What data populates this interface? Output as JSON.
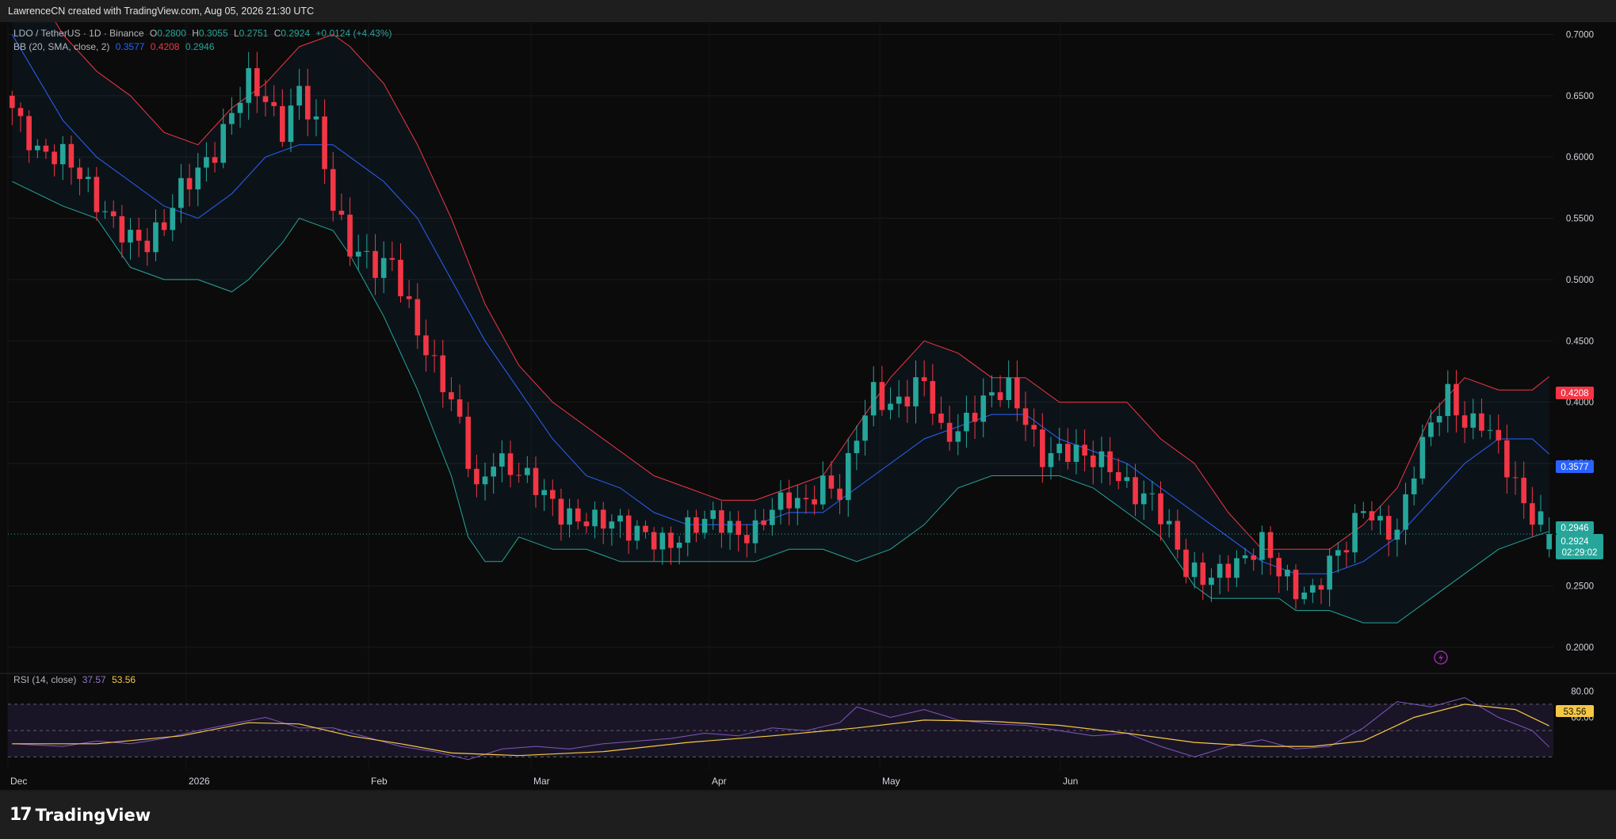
{
  "header": {
    "attribution": "LawrenceCN created with TradingView.com, Aug 05, 2026 21:30 UTC"
  },
  "legend": {
    "symbol": "LDO / TetherUS · 1D · Binance",
    "o_label": "O",
    "open": "0.2800",
    "h_label": "H",
    "high": "0.3055",
    "l_label": "L",
    "low": "0.2751",
    "c_label": "C",
    "close": "0.2924",
    "change": "+0.0124 (+4.43%)",
    "bb_name": "BB (20, SMA, close, 2)",
    "bb_basis": "0.3577",
    "bb_upper": "0.4208",
    "bb_lower": "0.2946"
  },
  "rsi_legend": {
    "name": "RSI (14, close)",
    "rsi": "37.57",
    "rsi_ma": "53.56"
  },
  "price_badges": {
    "bb_upper": "0.4208",
    "bb_basis": "0.3577",
    "bb_lower": "0.2946",
    "last_price": "0.2924",
    "countdown": "02:29:02"
  },
  "rsi_badge": "53.56",
  "brand": {
    "name": "TradingView",
    "mark": "17"
  },
  "colors": {
    "up": "#26a69a",
    "down": "#f23645",
    "basis": "#2962ff",
    "upper": "#f23645",
    "lower": "#26a69a",
    "rsi": "#7e57c2",
    "rsi_ma": "#f7c744"
  },
  "chart_data": {
    "type": "candlestick",
    "symbol": "LDO / TetherUS",
    "interval": "1D",
    "exchange": "Binance",
    "y_ticks": [
      0.7,
      0.65,
      0.6,
      0.55,
      0.5,
      0.45,
      0.4,
      0.35,
      0.25,
      0.2
    ],
    "y_tick_labels": [
      "0.7000",
      "0.6500",
      "0.6000",
      "0.5500",
      "0.5000",
      "0.4500",
      "0.4000",
      "0.3500",
      "0.2500",
      "0.2000"
    ],
    "y_range": [
      0.18,
      0.71
    ],
    "x_labels": [
      "Dec",
      "2026",
      "Feb",
      "Mar",
      "Apr",
      "May",
      "Jun"
    ],
    "close_path": [
      [
        0,
        0.64
      ],
      [
        3,
        0.61
      ],
      [
        6,
        0.6
      ],
      [
        8,
        0.58
      ],
      [
        10,
        0.56
      ],
      [
        12,
        0.55
      ],
      [
        14,
        0.54
      ],
      [
        16,
        0.53
      ],
      [
        18,
        0.54
      ],
      [
        20,
        0.57
      ],
      [
        22,
        0.59
      ],
      [
        24,
        0.61
      ],
      [
        26,
        0.64
      ],
      [
        28,
        0.66
      ],
      [
        30,
        0.64
      ],
      [
        32,
        0.62
      ],
      [
        34,
        0.66
      ],
      [
        36,
        0.63
      ],
      [
        38,
        0.56
      ],
      [
        40,
        0.52
      ],
      [
        43,
        0.51
      ],
      [
        45,
        0.52
      ],
      [
        47,
        0.48
      ],
      [
        49,
        0.44
      ],
      [
        51,
        0.41
      ],
      [
        53,
        0.38
      ],
      [
        55,
        0.33
      ],
      [
        57,
        0.36
      ],
      [
        60,
        0.34
      ],
      [
        63,
        0.32
      ],
      [
        65,
        0.31
      ],
      [
        68,
        0.31
      ],
      [
        71,
        0.3
      ],
      [
        73,
        0.29
      ],
      [
        75,
        0.29
      ],
      [
        78,
        0.29
      ],
      [
        80,
        0.3
      ],
      [
        83,
        0.3
      ],
      [
        86,
        0.29
      ],
      [
        88,
        0.3
      ],
      [
        90,
        0.32
      ],
      [
        92,
        0.32
      ],
      [
        94,
        0.31
      ],
      [
        96,
        0.33
      ],
      [
        98,
        0.33
      ],
      [
        100,
        0.38
      ],
      [
        102,
        0.41
      ],
      [
        104,
        0.39
      ],
      [
        106,
        0.4
      ],
      [
        108,
        0.42
      ],
      [
        110,
        0.38
      ],
      [
        112,
        0.38
      ],
      [
        114,
        0.39
      ],
      [
        116,
        0.4
      ],
      [
        118,
        0.41
      ],
      [
        120,
        0.39
      ],
      [
        122,
        0.36
      ],
      [
        124,
        0.36
      ],
      [
        127,
        0.35
      ],
      [
        130,
        0.35
      ],
      [
        133,
        0.33
      ],
      [
        135,
        0.32
      ],
      [
        137,
        0.29
      ],
      [
        139,
        0.26
      ],
      [
        141,
        0.26
      ],
      [
        144,
        0.27
      ],
      [
        146,
        0.27
      ],
      [
        148,
        0.28
      ],
      [
        150,
        0.26
      ],
      [
        152,
        0.25
      ],
      [
        154,
        0.25
      ],
      [
        156,
        0.27
      ],
      [
        158,
        0.28
      ],
      [
        160,
        0.31
      ],
      [
        162,
        0.3
      ],
      [
        164,
        0.3
      ],
      [
        166,
        0.35
      ],
      [
        168,
        0.38
      ],
      [
        170,
        0.4
      ],
      [
        172,
        0.38
      ],
      [
        174,
        0.39
      ],
      [
        176,
        0.37
      ],
      [
        178,
        0.33
      ],
      [
        180,
        0.3
      ],
      [
        182,
        0.2924
      ]
    ],
    "bb_upper": [
      [
        0,
        0.77
      ],
      [
        6,
        0.7
      ],
      [
        10,
        0.67
      ],
      [
        14,
        0.65
      ],
      [
        18,
        0.62
      ],
      [
        22,
        0.61
      ],
      [
        26,
        0.64
      ],
      [
        30,
        0.66
      ],
      [
        34,
        0.69
      ],
      [
        38,
        0.7
      ],
      [
        40,
        0.69
      ],
      [
        44,
        0.66
      ],
      [
        48,
        0.61
      ],
      [
        52,
        0.55
      ],
      [
        56,
        0.48
      ],
      [
        60,
        0.43
      ],
      [
        64,
        0.4
      ],
      [
        68,
        0.38
      ],
      [
        72,
        0.36
      ],
      [
        76,
        0.34
      ],
      [
        80,
        0.33
      ],
      [
        84,
        0.32
      ],
      [
        88,
        0.32
      ],
      [
        92,
        0.33
      ],
      [
        96,
        0.34
      ],
      [
        100,
        0.38
      ],
      [
        104,
        0.42
      ],
      [
        108,
        0.45
      ],
      [
        112,
        0.44
      ],
      [
        116,
        0.42
      ],
      [
        120,
        0.42
      ],
      [
        124,
        0.4
      ],
      [
        128,
        0.4
      ],
      [
        132,
        0.4
      ],
      [
        136,
        0.37
      ],
      [
        140,
        0.35
      ],
      [
        144,
        0.31
      ],
      [
        148,
        0.28
      ],
      [
        152,
        0.28
      ],
      [
        156,
        0.28
      ],
      [
        160,
        0.3
      ],
      [
        164,
        0.33
      ],
      [
        168,
        0.39
      ],
      [
        172,
        0.42
      ],
      [
        176,
        0.41
      ],
      [
        180,
        0.41
      ],
      [
        182,
        0.4208
      ]
    ],
    "bb_basis": [
      [
        0,
        0.7
      ],
      [
        6,
        0.63
      ],
      [
        10,
        0.6
      ],
      [
        14,
        0.58
      ],
      [
        18,
        0.56
      ],
      [
        22,
        0.55
      ],
      [
        26,
        0.57
      ],
      [
        30,
        0.6
      ],
      [
        34,
        0.61
      ],
      [
        38,
        0.61
      ],
      [
        40,
        0.6
      ],
      [
        44,
        0.58
      ],
      [
        48,
        0.55
      ],
      [
        52,
        0.5
      ],
      [
        56,
        0.45
      ],
      [
        60,
        0.41
      ],
      [
        64,
        0.37
      ],
      [
        68,
        0.34
      ],
      [
        72,
        0.33
      ],
      [
        76,
        0.31
      ],
      [
        80,
        0.3
      ],
      [
        84,
        0.3
      ],
      [
        88,
        0.3
      ],
      [
        92,
        0.31
      ],
      [
        96,
        0.31
      ],
      [
        100,
        0.33
      ],
      [
        104,
        0.35
      ],
      [
        108,
        0.37
      ],
      [
        112,
        0.38
      ],
      [
        116,
        0.39
      ],
      [
        120,
        0.39
      ],
      [
        124,
        0.37
      ],
      [
        128,
        0.36
      ],
      [
        132,
        0.35
      ],
      [
        136,
        0.33
      ],
      [
        140,
        0.31
      ],
      [
        144,
        0.29
      ],
      [
        148,
        0.27
      ],
      [
        152,
        0.26
      ],
      [
        156,
        0.26
      ],
      [
        160,
        0.27
      ],
      [
        164,
        0.29
      ],
      [
        168,
        0.32
      ],
      [
        172,
        0.35
      ],
      [
        176,
        0.37
      ],
      [
        180,
        0.37
      ],
      [
        182,
        0.3577
      ]
    ],
    "bb_lower": [
      [
        0,
        0.58
      ],
      [
        6,
        0.56
      ],
      [
        10,
        0.55
      ],
      [
        14,
        0.51
      ],
      [
        18,
        0.5
      ],
      [
        22,
        0.5
      ],
      [
        26,
        0.49
      ],
      [
        28,
        0.5
      ],
      [
        32,
        0.53
      ],
      [
        34,
        0.55
      ],
      [
        38,
        0.54
      ],
      [
        40,
        0.52
      ],
      [
        44,
        0.47
      ],
      [
        48,
        0.41
      ],
      [
        52,
        0.34
      ],
      [
        54,
        0.29
      ],
      [
        56,
        0.27
      ],
      [
        58,
        0.27
      ],
      [
        60,
        0.29
      ],
      [
        64,
        0.28
      ],
      [
        68,
        0.28
      ],
      [
        72,
        0.27
      ],
      [
        76,
        0.27
      ],
      [
        80,
        0.27
      ],
      [
        84,
        0.27
      ],
      [
        88,
        0.27
      ],
      [
        92,
        0.28
      ],
      [
        96,
        0.28
      ],
      [
        100,
        0.27
      ],
      [
        104,
        0.28
      ],
      [
        108,
        0.3
      ],
      [
        112,
        0.33
      ],
      [
        116,
        0.34
      ],
      [
        120,
        0.34
      ],
      [
        124,
        0.34
      ],
      [
        128,
        0.33
      ],
      [
        132,
        0.31
      ],
      [
        136,
        0.29
      ],
      [
        138,
        0.27
      ],
      [
        140,
        0.25
      ],
      [
        142,
        0.24
      ],
      [
        146,
        0.24
      ],
      [
        150,
        0.24
      ],
      [
        152,
        0.23
      ],
      [
        156,
        0.23
      ],
      [
        160,
        0.22
      ],
      [
        164,
        0.22
      ],
      [
        166,
        0.23
      ],
      [
        168,
        0.24
      ],
      [
        172,
        0.26
      ],
      [
        176,
        0.28
      ],
      [
        180,
        0.29
      ],
      [
        182,
        0.2946
      ]
    ],
    "rsi": {
      "ticks": [
        80,
        60
      ],
      "tick_labels": [
        "80.00",
        "60.00"
      ],
      "bands": [
        70,
        30
      ],
      "range": [
        20,
        85
      ],
      "rsi_path": [
        [
          0,
          40
        ],
        [
          6,
          38
        ],
        [
          10,
          42
        ],
        [
          14,
          40
        ],
        [
          18,
          44
        ],
        [
          22,
          50
        ],
        [
          26,
          55
        ],
        [
          30,
          60
        ],
        [
          34,
          52
        ],
        [
          38,
          52
        ],
        [
          42,
          45
        ],
        [
          46,
          38
        ],
        [
          50,
          34
        ],
        [
          54,
          28
        ],
        [
          58,
          36
        ],
        [
          62,
          38
        ],
        [
          66,
          36
        ],
        [
          70,
          40
        ],
        [
          74,
          42
        ],
        [
          78,
          44
        ],
        [
          82,
          48
        ],
        [
          86,
          46
        ],
        [
          90,
          52
        ],
        [
          94,
          50
        ],
        [
          98,
          56
        ],
        [
          100,
          68
        ],
        [
          104,
          60
        ],
        [
          108,
          66
        ],
        [
          112,
          58
        ],
        [
          116,
          55
        ],
        [
          120,
          54
        ],
        [
          124,
          50
        ],
        [
          128,
          46
        ],
        [
          132,
          48
        ],
        [
          136,
          38
        ],
        [
          140,
          30
        ],
        [
          144,
          38
        ],
        [
          148,
          43
        ],
        [
          152,
          36
        ],
        [
          156,
          38
        ],
        [
          160,
          52
        ],
        [
          164,
          72
        ],
        [
          168,
          68
        ],
        [
          172,
          75
        ],
        [
          176,
          60
        ],
        [
          180,
          50
        ],
        [
          182,
          37.57
        ]
      ],
      "ma_path": [
        [
          0,
          40
        ],
        [
          10,
          40
        ],
        [
          20,
          46
        ],
        [
          28,
          56
        ],
        [
          34,
          55
        ],
        [
          40,
          46
        ],
        [
          46,
          40
        ],
        [
          52,
          33
        ],
        [
          60,
          31
        ],
        [
          70,
          34
        ],
        [
          80,
          41
        ],
        [
          90,
          46
        ],
        [
          100,
          52
        ],
        [
          108,
          58
        ],
        [
          116,
          57
        ],
        [
          124,
          54
        ],
        [
          132,
          48
        ],
        [
          140,
          41
        ],
        [
          148,
          38
        ],
        [
          154,
          38
        ],
        [
          160,
          42
        ],
        [
          166,
          60
        ],
        [
          172,
          70
        ],
        [
          178,
          66
        ],
        [
          182,
          53.56
        ]
      ]
    }
  }
}
